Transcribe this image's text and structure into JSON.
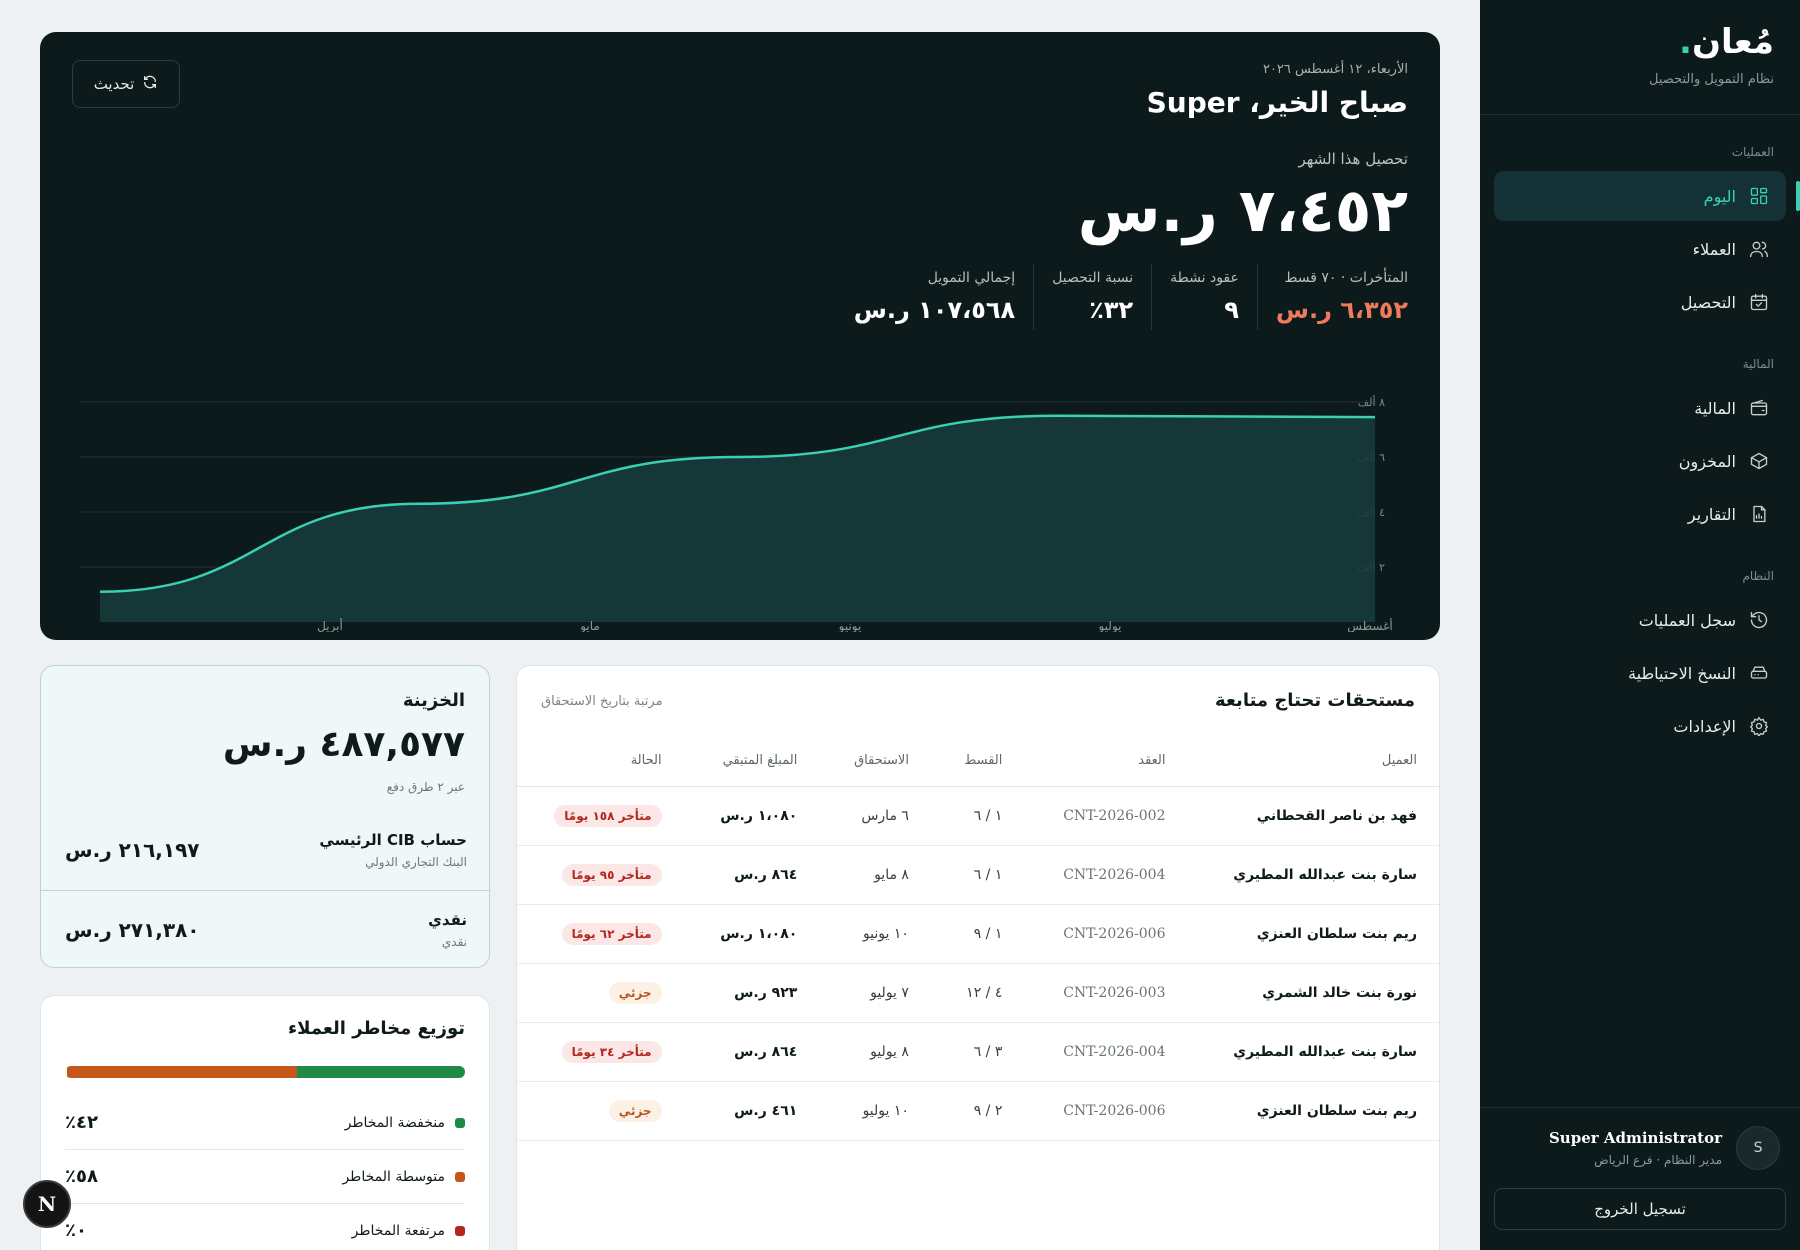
{
  "brand": {
    "name": "مُعان",
    "dot": ".",
    "subtitle": "نظام التمويل والتحصيل"
  },
  "nav": {
    "sections": [
      {
        "label": "العمليات",
        "items": [
          {
            "label": "اليوم",
            "icon": "dashboard-icon",
            "active": true
          },
          {
            "label": "العملاء",
            "icon": "users-icon"
          },
          {
            "label": "التحصيل",
            "icon": "calendar-check-icon"
          }
        ]
      },
      {
        "label": "المالية",
        "items": [
          {
            "label": "المالية",
            "icon": "wallet-icon"
          },
          {
            "label": "المخزون",
            "icon": "box-icon"
          },
          {
            "label": "التقارير",
            "icon": "report-icon"
          }
        ]
      },
      {
        "label": "النظام",
        "items": [
          {
            "label": "سجل العمليات",
            "icon": "history-icon"
          },
          {
            "label": "النسخ الاحتياطية",
            "icon": "backup-icon"
          },
          {
            "label": "الإعدادات",
            "icon": "gear-icon"
          }
        ]
      }
    ]
  },
  "user": {
    "initial": "S",
    "name": "Super Administrator",
    "role": "مدير النظام · فرع الرياض",
    "logout": "تسجيل الخروج"
  },
  "hero": {
    "date": "الأربعاء، ١٢ أغسطس ٢٠٢٦",
    "greeting": "صباح الخير، Super",
    "refresh": "تحديث",
    "collection_label": "تحصيل هذا الشهر",
    "collection_amount": "٧،٤٥٢ ر.س",
    "stats": [
      {
        "label": "المتأخرات · ٧٠ قسط",
        "value": "٦،٣٥٢ ر.س",
        "late": true
      },
      {
        "label": "عقود نشطة",
        "value": "٩"
      },
      {
        "label": "نسبة التحصيل",
        "value": "٣٢٪"
      },
      {
        "label": "إجمالي التمويل",
        "value": "١٠٧،٥٦٨ ر.س"
      }
    ]
  },
  "chart_data": {
    "type": "area",
    "x": [
      "أبريل",
      "مايو",
      "يونيو",
      "يوليو",
      "أغسطس"
    ],
    "series": [
      {
        "values": [
          1100,
          4300,
          6000,
          7500,
          7452
        ]
      }
    ],
    "y_ticks": [
      "٢ ألف",
      "٤ ألف",
      "٦ ألف",
      "٨ ألف"
    ],
    "ylim": [
      0,
      8000
    ],
    "grid": true,
    "color": "#3ad0b4"
  },
  "due": {
    "title": "مستحقات تحتاج متابعة",
    "subtitle": "مرتبة بتاريخ الاستحقاق",
    "columns": [
      "العميل",
      "العقد",
      "القسط",
      "الاستحقاق",
      "المبلغ المتبقي",
      "الحالة"
    ],
    "rows": [
      {
        "customer": "فهد بن ناصر القحطاني",
        "contract": "CNT-2026-002",
        "installment": "١ / ٦",
        "due": "٦ مارس",
        "remaining": "١،٠٨٠ ر.س",
        "status": "متأخر ١٥٨ يومًا",
        "status_type": "late"
      },
      {
        "customer": "سارة بنت عبدالله المطيري",
        "contract": "CNT-2026-004",
        "installment": "١ / ٦",
        "due": "٨ مايو",
        "remaining": "٨٦٤ ر.س",
        "status": "متأخر ٩٥ يومًا",
        "status_type": "late"
      },
      {
        "customer": "ريم بنت سلطان العنزي",
        "contract": "CNT-2026-006",
        "installment": "١ / ٩",
        "due": "١٠ يونيو",
        "remaining": "١،٠٨٠ ر.س",
        "status": "متأخر ٦٢ يومًا",
        "status_type": "late"
      },
      {
        "customer": "نورة بنت خالد الشمري",
        "contract": "CNT-2026-003",
        "installment": "٤ / ١٢",
        "due": "٧ يوليو",
        "remaining": "٩٢٣ ر.س",
        "status": "جزئي",
        "status_type": "partial"
      },
      {
        "customer": "سارة بنت عبدالله المطيري",
        "contract": "CNT-2026-004",
        "installment": "٣ / ٦",
        "due": "٨ يوليو",
        "remaining": "٨٦٤ ر.س",
        "status": "متأخر ٣٤ يومًا",
        "status_type": "late"
      },
      {
        "customer": "ريم بنت سلطان العنزي",
        "contract": "CNT-2026-006",
        "installment": "٢ / ٩",
        "due": "١٠ يوليو",
        "remaining": "٤٦١ ر.س",
        "status": "جزئي",
        "status_type": "partial"
      }
    ]
  },
  "treasury": {
    "title": "الخزينة",
    "amount": "٤٨٧,٥٧٧ ر.س",
    "subtitle": "عبر ٢ طرق دفع",
    "accounts": [
      {
        "name": "حساب CIB الرئيسي",
        "bank": "البنك التجاري الدولي",
        "value": "٢١٦,١٩٧ ر.س"
      },
      {
        "name": "نقدي",
        "bank": "نقدي",
        "value": "٢٧١,٣٨٠ ر.س"
      }
    ]
  },
  "risk": {
    "title": "توزيع مخاطر العملاء",
    "items": [
      {
        "label": "منخفضة المخاطر",
        "pct": "٤٢٪",
        "value": 42,
        "color": "#1e8a46"
      },
      {
        "label": "متوسطة المخاطر",
        "pct": "٥٨٪",
        "value": 58,
        "color": "#c5561a"
      },
      {
        "label": "مرتفعة المخاطر",
        "pct": "٠٪",
        "value": 0,
        "color": "#b3261e"
      }
    ]
  },
  "fab": {
    "label": "N"
  }
}
